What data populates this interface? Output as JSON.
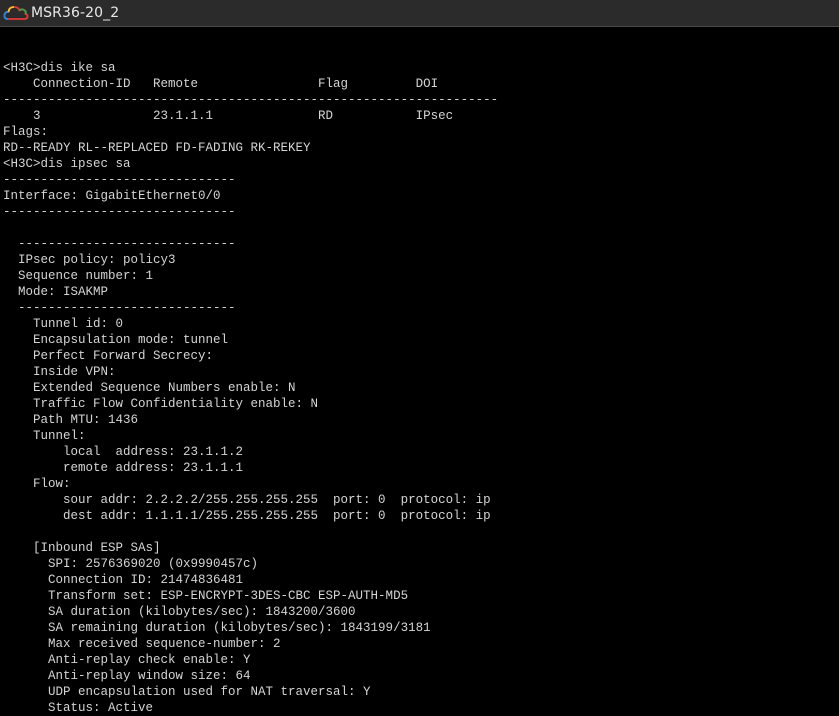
{
  "window": {
    "title": "MSR36-20_2",
    "icon": "cloud-device-icon"
  },
  "colors": {
    "titlebar_bg": "#2b2b2b",
    "terminal_bg": "#000000",
    "terminal_fg": "#d4d4d4"
  },
  "terminal": {
    "lines": [
      "",
      "",
      "<H3C>dis ike sa",
      "    Connection-ID   Remote                Flag         DOI",
      "------------------------------------------------------------------",
      "    3               23.1.1.1              RD           IPsec",
      "Flags:",
      "RD--READY RL--REPLACED FD-FADING RK-REKEY",
      "<H3C>dis ipsec sa",
      "-------------------------------",
      "Interface: GigabitEthernet0/0",
      "-------------------------------",
      "",
      "  -----------------------------",
      "  IPsec policy: policy3",
      "  Sequence number: 1",
      "  Mode: ISAKMP",
      "  -----------------------------",
      "    Tunnel id: 0",
      "    Encapsulation mode: tunnel",
      "    Perfect Forward Secrecy:",
      "    Inside VPN:",
      "    Extended Sequence Numbers enable: N",
      "    Traffic Flow Confidentiality enable: N",
      "    Path MTU: 1436",
      "    Tunnel:",
      "        local  address: 23.1.1.2",
      "        remote address: 23.1.1.1",
      "    Flow:",
      "        sour addr: 2.2.2.2/255.255.255.255  port: 0  protocol: ip",
      "        dest addr: 1.1.1.1/255.255.255.255  port: 0  protocol: ip",
      "",
      "    [Inbound ESP SAs]",
      "      SPI: 2576369020 (0x9990457c)",
      "      Connection ID: 21474836481",
      "      Transform set: ESP-ENCRYPT-3DES-CBC ESP-AUTH-MD5",
      "      SA duration (kilobytes/sec): 1843200/3600",
      "      SA remaining duration (kilobytes/sec): 1843199/3181",
      "      Max received sequence-number: 2",
      "      Anti-replay check enable: Y",
      "      Anti-replay window size: 64",
      "      UDP encapsulation used for NAT traversal: Y",
      "      Status: Active"
    ]
  }
}
